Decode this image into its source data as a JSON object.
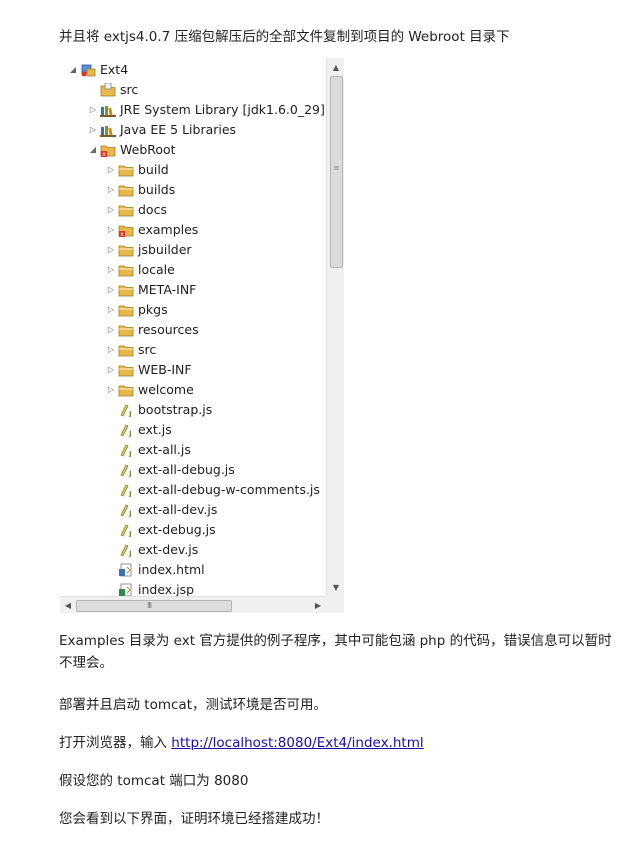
{
  "intro": "并且将 extjs4.0.7 压缩包解压后的全部文件复制到项目的 Webroot 目录下",
  "tree": [
    {
      "label": "Ext4",
      "level": 0,
      "twisty": "open",
      "icon": "project-icon"
    },
    {
      "label": "src",
      "level": 1,
      "twisty": "none",
      "icon": "source-folder-icon"
    },
    {
      "label": "JRE System Library [jdk1.6.0_29]",
      "level": 1,
      "twisty": "closed",
      "icon": "library-icon"
    },
    {
      "label": "Java EE 5 Libraries",
      "level": 1,
      "twisty": "closed",
      "icon": "library-icon"
    },
    {
      "label": "WebRoot",
      "level": 1,
      "twisty": "open",
      "icon": "webroot-folder-icon"
    },
    {
      "label": "build",
      "level": 2,
      "twisty": "closed",
      "icon": "folder-icon"
    },
    {
      "label": "builds",
      "level": 2,
      "twisty": "closed",
      "icon": "folder-icon"
    },
    {
      "label": "docs",
      "level": 2,
      "twisty": "closed",
      "icon": "folder-icon"
    },
    {
      "label": "examples",
      "level": 2,
      "twisty": "closed",
      "icon": "error-folder-icon"
    },
    {
      "label": "jsbuilder",
      "level": 2,
      "twisty": "closed",
      "icon": "folder-icon"
    },
    {
      "label": "locale",
      "level": 2,
      "twisty": "closed",
      "icon": "folder-icon"
    },
    {
      "label": "META-INF",
      "level": 2,
      "twisty": "closed",
      "icon": "folder-icon"
    },
    {
      "label": "pkgs",
      "level": 2,
      "twisty": "closed",
      "icon": "folder-icon"
    },
    {
      "label": "resources",
      "level": 2,
      "twisty": "closed",
      "icon": "folder-icon"
    },
    {
      "label": "src",
      "level": 2,
      "twisty": "closed",
      "icon": "folder-icon"
    },
    {
      "label": "WEB-INF",
      "level": 2,
      "twisty": "closed",
      "icon": "folder-icon"
    },
    {
      "label": "welcome",
      "level": 2,
      "twisty": "closed",
      "icon": "folder-icon"
    },
    {
      "label": "bootstrap.js",
      "level": 2,
      "twisty": "none",
      "icon": "js-file-icon"
    },
    {
      "label": "ext.js",
      "level": 2,
      "twisty": "none",
      "icon": "js-file-icon"
    },
    {
      "label": "ext-all.js",
      "level": 2,
      "twisty": "none",
      "icon": "js-file-icon"
    },
    {
      "label": "ext-all-debug.js",
      "level": 2,
      "twisty": "none",
      "icon": "js-file-icon"
    },
    {
      "label": "ext-all-debug-w-comments.js",
      "level": 2,
      "twisty": "none",
      "icon": "js-file-icon"
    },
    {
      "label": "ext-all-dev.js",
      "level": 2,
      "twisty": "none",
      "icon": "js-file-icon"
    },
    {
      "label": "ext-debug.js",
      "level": 2,
      "twisty": "none",
      "icon": "js-file-icon"
    },
    {
      "label": "ext-dev.js",
      "level": 2,
      "twisty": "none",
      "icon": "js-file-icon"
    },
    {
      "label": "index.html",
      "level": 2,
      "twisty": "none",
      "icon": "html-file-icon"
    },
    {
      "label": "index.jsp",
      "level": 2,
      "twisty": "none",
      "icon": "jsp-file-icon"
    }
  ],
  "colors": {
    "folder": "#e9b84a",
    "error": "#d8322b",
    "js": "#7a8a2a",
    "link": "#1a0dab"
  },
  "para_examples": "Examples 目录为 ext 官方提供的例子程序，其中可能包涵 php 的代码，错误信息可以暂时不理会。",
  "para_deploy": "部署并且启动 tomcat，测试环境是否可用。",
  "para_open_prefix": "打开浏览器，输入 ",
  "para_open_link": "http://localhost:8080/Ext4/index.html",
  "para_port": "假设您的 tomcat 端口为 8080",
  "para_success": "您会看到以下界面，证明环境已经搭建成功！"
}
